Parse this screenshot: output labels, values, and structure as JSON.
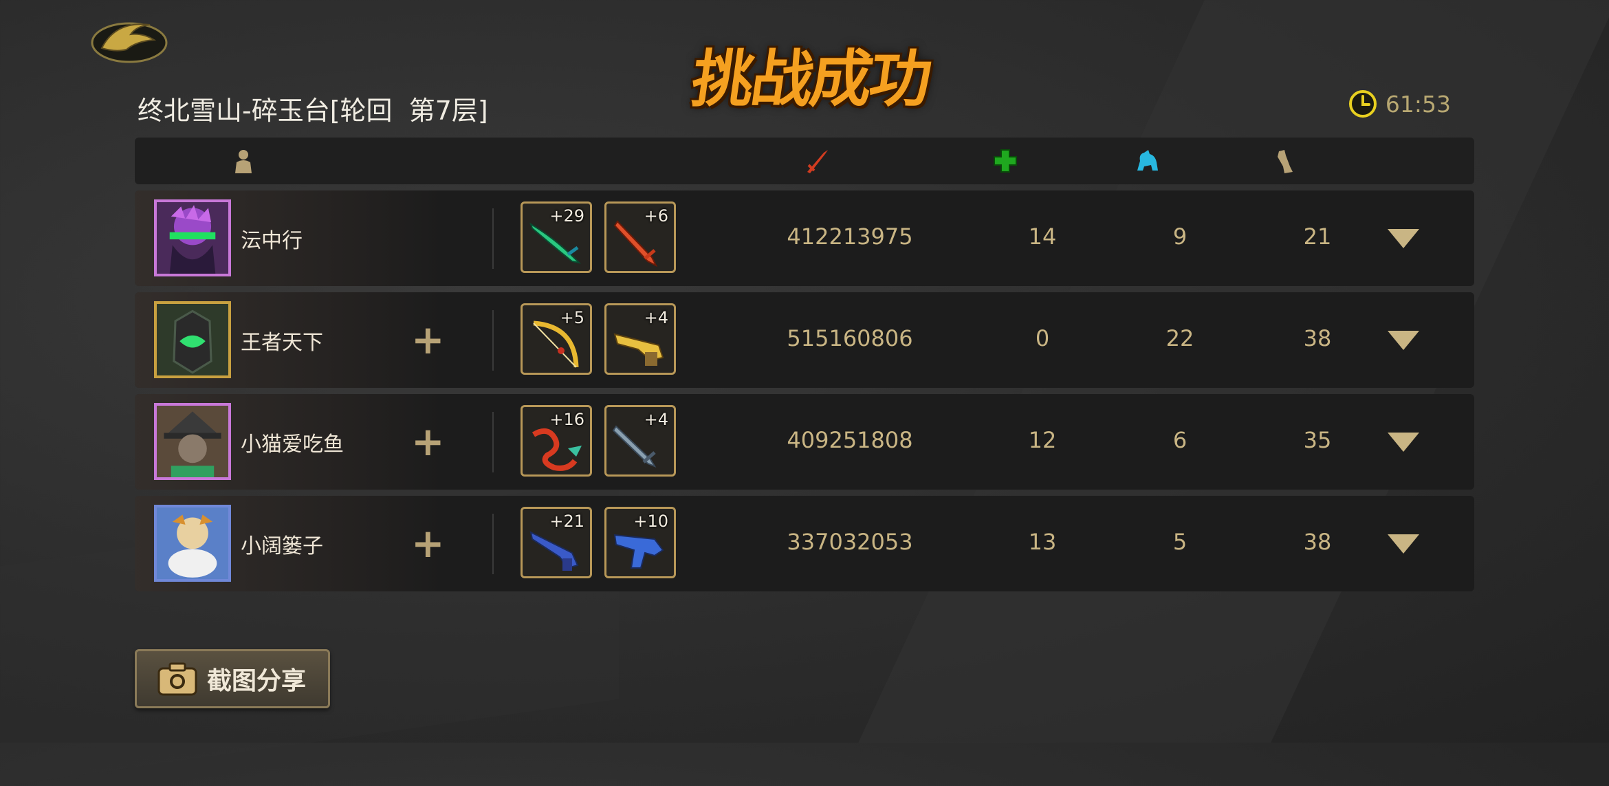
{
  "title": "挑战成功",
  "stage": "终北雪山-碎玉台[轮回  第7层]",
  "timer": "61:53",
  "header": {
    "icons": [
      "player-icon",
      "damage-icon",
      "heal-icon",
      "kill-icon",
      "revive-icon"
    ]
  },
  "players": [
    {
      "name": "沄中行",
      "weapons": [
        {
          "level": "+29",
          "icon": "green-sword-icon"
        },
        {
          "level": "+6",
          "icon": "flame-sword-icon"
        }
      ],
      "damage": "412213975",
      "heal": "14",
      "kills": "9",
      "revives": "21",
      "avatar_border": "#c878d8"
    },
    {
      "name": "王者天下",
      "weapons": [
        {
          "level": "+5",
          "icon": "golden-bow-icon"
        },
        {
          "level": "+4",
          "icon": "golden-gun-icon"
        }
      ],
      "damage": "515160806",
      "heal": "0",
      "kills": "22",
      "revives": "38",
      "avatar_border": "#c8a040"
    },
    {
      "name": "小猫爱吃鱼",
      "weapons": [
        {
          "level": "+16",
          "icon": "dragon-staff-icon"
        },
        {
          "level": "+4",
          "icon": "steel-sword-icon"
        }
      ],
      "damage": "409251808",
      "heal": "12",
      "kills": "6",
      "revives": "35",
      "avatar_border": "#c878d8"
    },
    {
      "name": "小阔篓子",
      "weapons": [
        {
          "level": "+21",
          "icon": "blue-rifle-icon"
        },
        {
          "level": "+10",
          "icon": "blue-pistol-icon"
        }
      ],
      "damage": "337032053",
      "heal": "13",
      "kills": "5",
      "revives": "38",
      "avatar_border": "#7088d8"
    }
  ],
  "share_button": "截图分享",
  "colors": {
    "accent": "#f5a020",
    "gold": "#c9b584",
    "damage": "#d23c20",
    "heal": "#1fa81f",
    "kill": "#28b8e0"
  }
}
